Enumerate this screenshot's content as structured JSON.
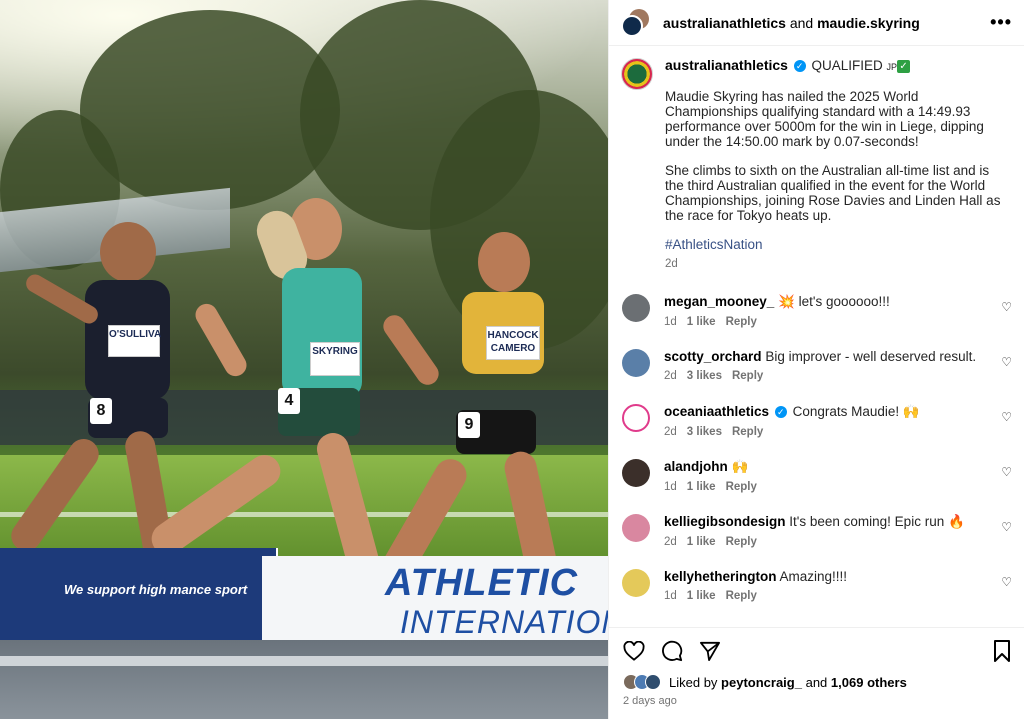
{
  "photo": {
    "banner_left_text": "We support high         mance sport",
    "banner_right_line1": "ATHLETIC",
    "banner_right_line2": "INTERNATIONA",
    "runners": [
      {
        "bib": "O'SULLIVA",
        "hip_number": "8"
      },
      {
        "bib": "SKYRING",
        "hip_number": "4"
      },
      {
        "bib": "HANCOCK CAMERO",
        "hip_number": "9"
      }
    ]
  },
  "header": {
    "user1": "australianathletics",
    "and": "and",
    "user2": "maudie.skyring",
    "more_icon": "more-horizontal-icon"
  },
  "caption": {
    "username": "australianathletics",
    "headline": "QUALIFIED",
    "jp_badge": "JP",
    "para1": "Maudie Skyring has nailed the 2025 World Championships qualifying standard with a 14:49.93 performance over 5000m for the win in Liege, dipping under the 14:50.00 mark by 0.07-seconds!",
    "para2": "She climbs to sixth on the Australian all-time list and is the third Australian qualified in the event for the World Championships, joining Rose Davies and Linden Hall as the race for Tokyo heats up.",
    "hashtag": "#AthleticsNation",
    "time": "2d"
  },
  "comments": [
    {
      "username": "megan_mooney_",
      "text": "💥 let's goooooo!!!",
      "time": "1d",
      "likes": "1 like",
      "reply": "Reply",
      "avatar_color": "#6b6f73"
    },
    {
      "username": "scotty_orchard",
      "text": "Big improver - well deserved result.",
      "time": "2d",
      "likes": "3 likes",
      "reply": "Reply",
      "avatar_color": "#5a7fa8"
    },
    {
      "username": "oceaniaathletics",
      "text": "Congrats Maudie! 🙌",
      "time": "2d",
      "likes": "3 likes",
      "reply": "Reply",
      "avatar_color": "#ffffff",
      "verified": true
    },
    {
      "username": "alandjohn",
      "text": "🙌",
      "time": "1d",
      "likes": "1 like",
      "reply": "Reply",
      "avatar_color": "#3b2f2a"
    },
    {
      "username": "kelliegibsondesign",
      "text": "It's been coming! Epic run 🔥",
      "time": "2d",
      "likes": "1 like",
      "reply": "Reply",
      "avatar_color": "#d987a0"
    },
    {
      "username": "kellyhetherington",
      "text": "Amazing!!!!",
      "time": "1d",
      "likes": "1 like",
      "reply": "Reply",
      "avatar_color": "#e4c95a"
    }
  ],
  "actions": {
    "liked_by": "Liked by",
    "liker": "peytoncraig_",
    "and": "and",
    "others": "1,069 others",
    "time_ago": "2 days ago"
  },
  "colors": {
    "link": "#385185",
    "verified": "#0095f6",
    "meta": "#737373"
  }
}
